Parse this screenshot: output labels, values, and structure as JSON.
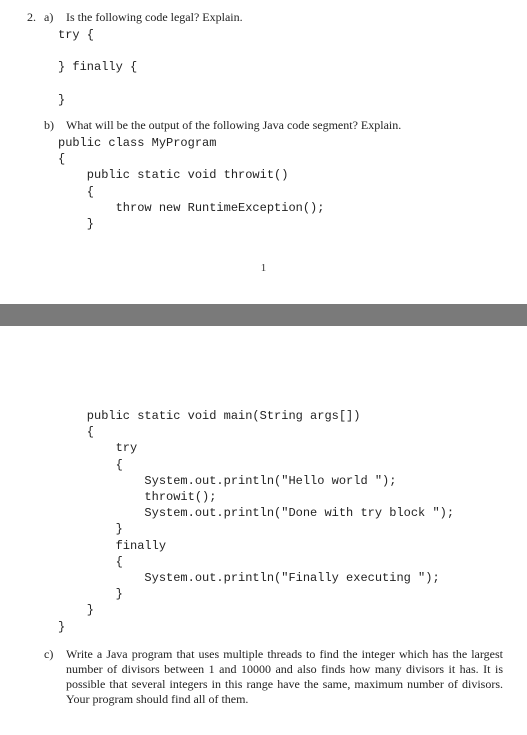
{
  "q2a": {
    "number": "2.",
    "letter": "a)",
    "text": "Is the following code legal? Explain.",
    "code": "try {\n\n} finally {\n\n}"
  },
  "q2b": {
    "letter": "b)",
    "text": "What will be the output of the following Java code segment? Explain.",
    "code_top": "public class MyProgram\n{\n    public static void throwit()\n    {\n        throw new RuntimeException();\n    }",
    "code_bottom": "    public static void main(String args[])\n    {\n        try\n        {\n            System.out.println(\"Hello world \");\n            throwit();\n            System.out.println(\"Done with try block \");\n        }\n        finally\n        {\n            System.out.println(\"Finally executing \");\n        }\n    }\n}"
  },
  "page_number": "1",
  "q2c": {
    "letter": "c)",
    "text": "Write a Java program that uses multiple threads to find the integer which has the largest number of divisors between 1 and 10000 and also finds how many divisors it has. It is possible that several integers in this range have the same, maximum number of divisors. Your program should find all of them."
  }
}
